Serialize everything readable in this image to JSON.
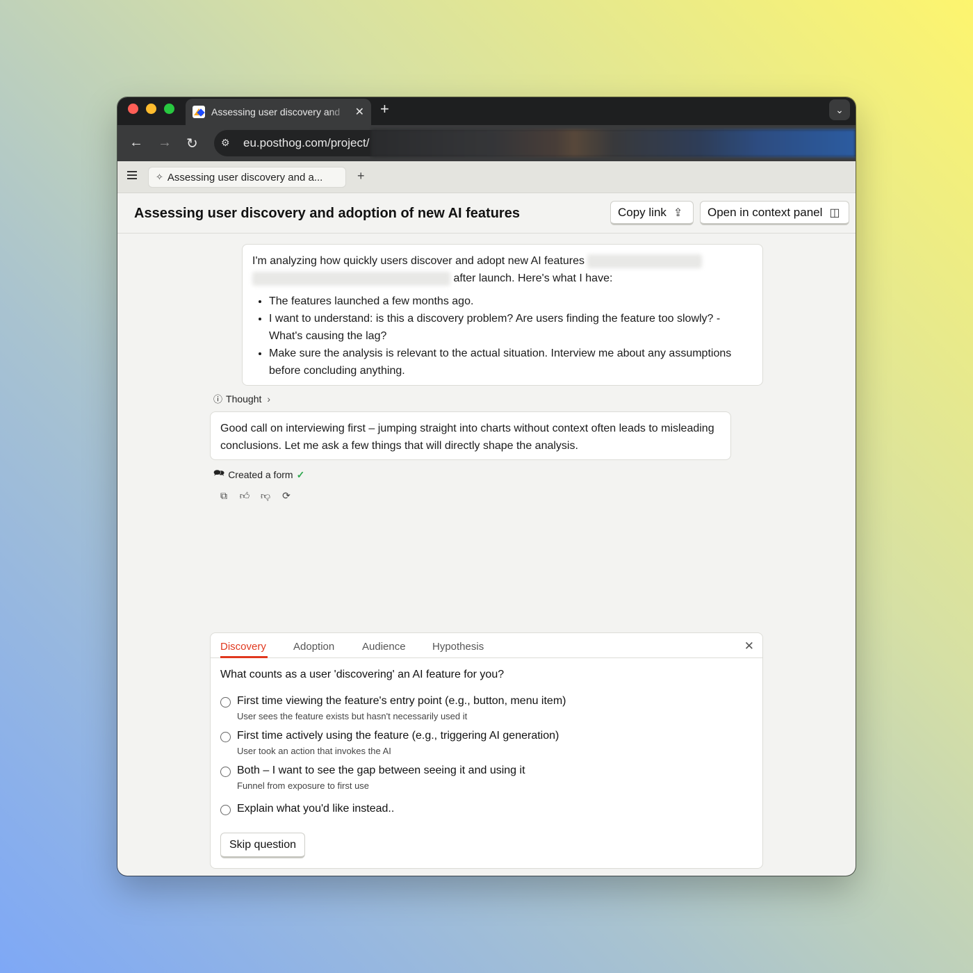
{
  "browser": {
    "tab_title": "Assessing user discovery and",
    "url": "eu.posthog.com/project/"
  },
  "app": {
    "tab_title": "Assessing user discovery and a...",
    "page_title": "Assessing user discovery and adoption of new AI features",
    "copy_link_label": "Copy link",
    "open_context_label": "Open in context panel"
  },
  "user_message": {
    "line1": "I'm analyzing how quickly users discover and adopt new AI features",
    "line2": "after launch. Here's what I have:",
    "bullets": [
      "The features launched a few months ago.",
      "I want to understand: is this a discovery problem? Are users finding the feature too slowly? - What's causing the lag?",
      "Make sure the analysis is relevant to the actual situation. Interview me about any assumptions before concluding anything."
    ]
  },
  "thought_label": "Thought",
  "ai_message": "Good call on interviewing first – jumping straight into charts without context often leads to misleading conclusions. Let me ask a few things that will directly shape the analysis.",
  "created_label": "Created a form",
  "form": {
    "tabs": [
      "Discovery",
      "Adoption",
      "Audience",
      "Hypothesis"
    ],
    "active_tab": "Discovery",
    "question": "What counts as a user 'discovering' an AI feature for you?",
    "options": [
      {
        "label": "First time viewing the feature's entry point (e.g., button, menu item)",
        "desc": "User sees the feature exists but hasn't necessarily used it"
      },
      {
        "label": "First time actively using the feature (e.g., triggering AI generation)",
        "desc": "User took an action that invokes the AI"
      },
      {
        "label": "Both – I want to see the gap between seeing it and using it",
        "desc": "Funnel from exposure to first use"
      },
      {
        "label": "Explain what you'd like instead..",
        "desc": ""
      }
    ],
    "skip_label": "Skip question"
  },
  "colors": {
    "accent": "#e0381e",
    "success": "#2fa84f"
  }
}
